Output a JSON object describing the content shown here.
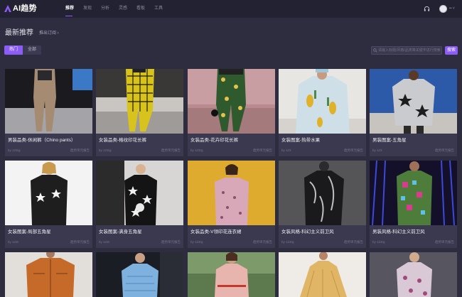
{
  "header": {
    "logo_text": "AI趋势",
    "nav": [
      "推荐",
      "发现",
      "分析",
      "灵感",
      "看板",
      "工具"
    ],
    "active_nav": "推荐",
    "user_menu": "•• ˅"
  },
  "page": {
    "title": "最新推荐",
    "subscribe_label": "推出订阅 ›"
  },
  "filters": [
    "热门",
    "全部"
  ],
  "search": {
    "placeholder": "请输入标题/风格/品类等关键字进行搜索",
    "button_label": "搜索"
  },
  "accent_color": "#8b5cf6",
  "cards": [
    {
      "title": "男装品类-休闲裤（Chino pants）",
      "meta_left": "by 123rg",
      "meta_right": "趋势单元报告"
    },
    {
      "title": "女装品类-格纹印花长裤",
      "meta_left": "by 123rg",
      "meta_right": "趋势单元报告"
    },
    {
      "title": "女装品类-花卉印花长裤",
      "meta_left": "by 123rg",
      "meta_right": "趋势单元报告"
    },
    {
      "title": "女装图案-热带水果",
      "meta_left": "by 123",
      "meta_right": "趋势单元报告"
    },
    {
      "title": "男装图案-五角星",
      "meta_left": "by 123",
      "meta_right": "趋势单元报告"
    },
    {
      "title": "女装图案-局部五角星",
      "meta_left": "by 123t",
      "meta_right": "趋势单元报告"
    },
    {
      "title": "女装图案-满身五角星",
      "meta_left": "by 123t",
      "meta_right": "趋势单元报告"
    },
    {
      "title": "女装品类-V领印花连衣裙",
      "meta_left": "by 123rg",
      "meta_right": "趋势单元报告"
    },
    {
      "title": "女装风格-科幻主义前卫风",
      "meta_left": "by 123rg",
      "meta_right": "趋势单元报告"
    },
    {
      "title": "男装风格-科幻主义前卫风",
      "meta_left": "by 123rg",
      "meta_right": "趋势单元报告"
    },
    {
      "title": "",
      "meta_left": "",
      "meta_right": ""
    },
    {
      "title": "",
      "meta_left": "",
      "meta_right": ""
    },
    {
      "title": "",
      "meta_left": "",
      "meta_right": ""
    },
    {
      "title": "",
      "meta_left": "",
      "meta_right": ""
    },
    {
      "title": "",
      "meta_left": "",
      "meta_right": ""
    }
  ]
}
